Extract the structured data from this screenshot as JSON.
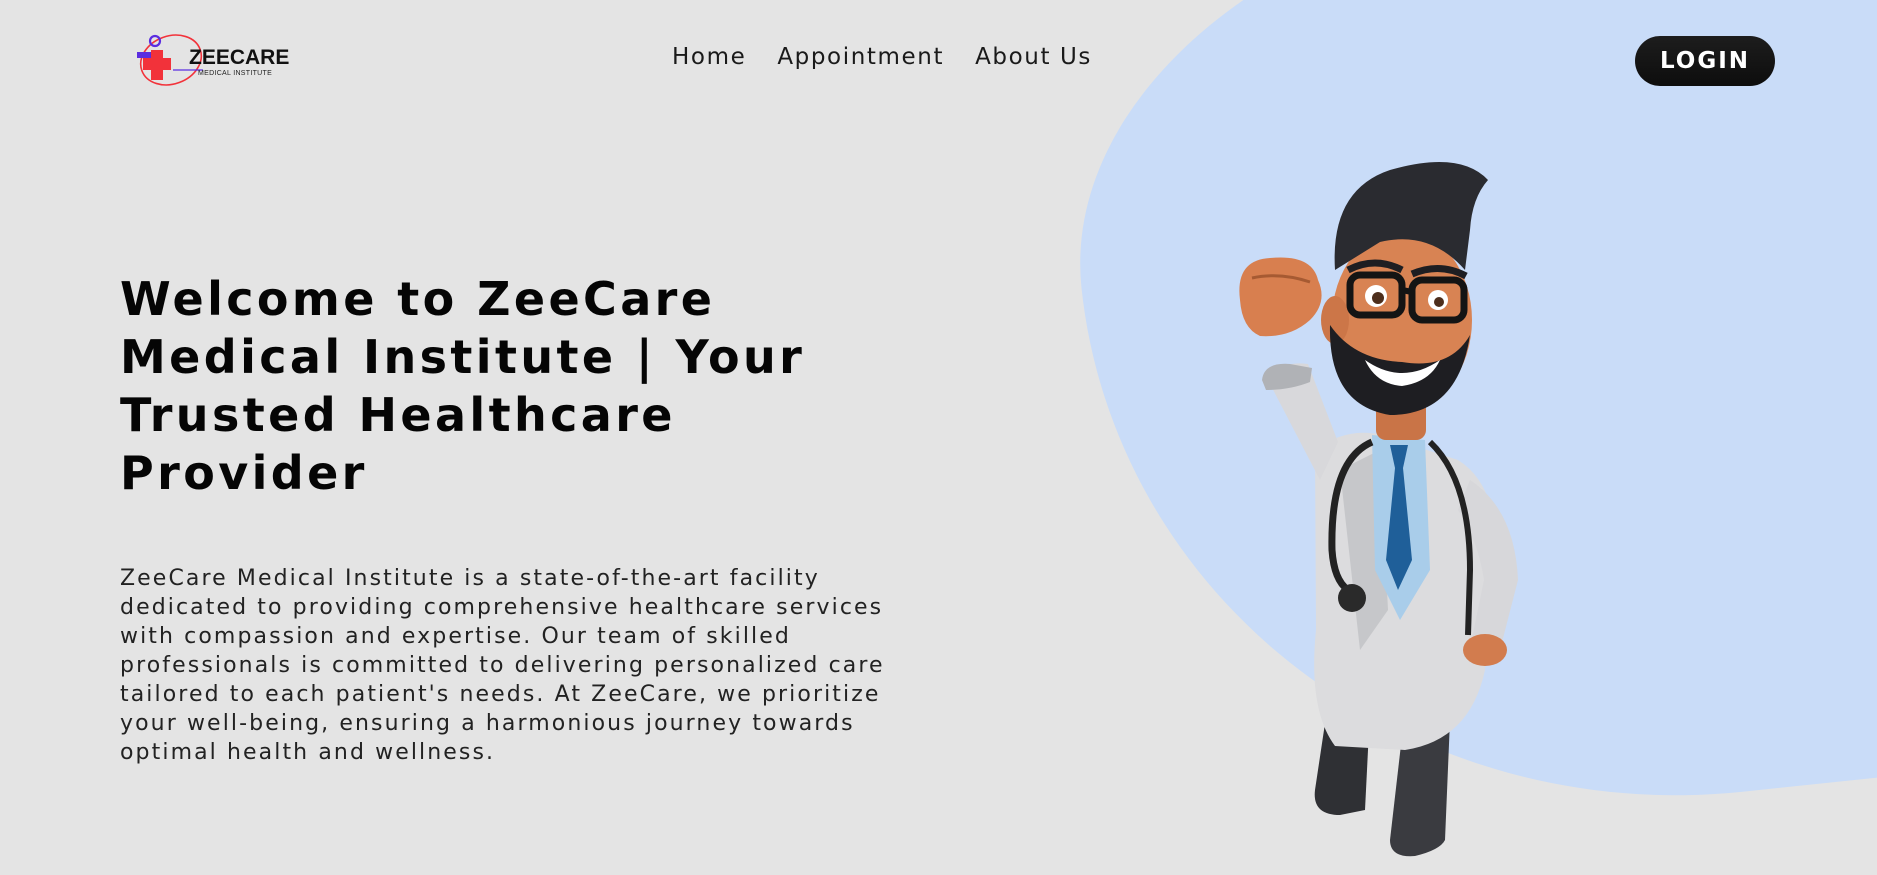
{
  "brand": {
    "name": "ZEECARE",
    "tagline": "MEDICAL INSTITUTE",
    "colors": {
      "cross": "#f2323a",
      "accent": "#5b2de0"
    }
  },
  "nav": {
    "items": [
      {
        "label": "Home"
      },
      {
        "label": "Appointment"
      },
      {
        "label": "About Us"
      }
    ]
  },
  "login_label": "LOGIN",
  "hero": {
    "title": "Welcome to ZeeCare Medical Institute | Your Trusted Healthcare Provider",
    "description": "ZeeCare Medical Institute is a state-of-the-art facility dedicated to providing comprehensive healthcare services with compassion and expertise. Our team of skilled professionals is committed to delivering personalized care tailored to each patient's needs. At ZeeCare, we prioritize your well-being, ensuring a harmonious journey towards optimal health and wellness."
  },
  "colors": {
    "background": "#e4e4e4",
    "blob": "#c9dcf8",
    "button": "#111111"
  }
}
